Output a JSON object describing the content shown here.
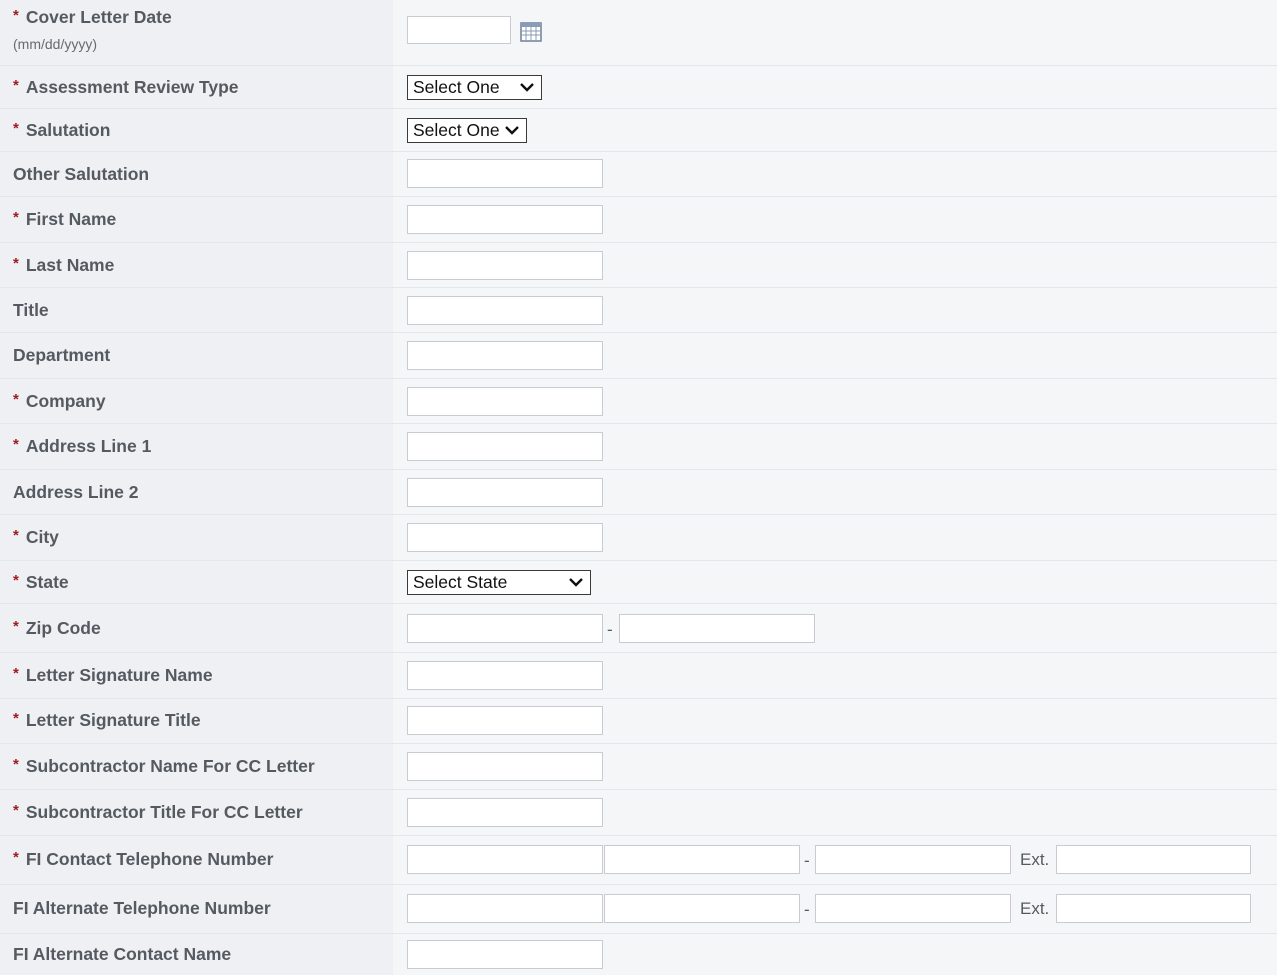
{
  "form": {
    "cover_letter_date": {
      "label": "Cover Letter Date",
      "hint": "(mm/dd/yyyy)",
      "value": "",
      "calendar_icon": "calendar-icon"
    },
    "assessment_review_type": {
      "label": "Assessment Review Type",
      "selected": "Select One"
    },
    "salutation": {
      "label": "Salutation",
      "selected": "Select One"
    },
    "other_salutation": {
      "label": "Other Salutation",
      "value": ""
    },
    "first_name": {
      "label": "First Name",
      "value": ""
    },
    "last_name": {
      "label": "Last Name",
      "value": ""
    },
    "title": {
      "label": "Title",
      "value": ""
    },
    "department": {
      "label": "Department",
      "value": ""
    },
    "company": {
      "label": "Company",
      "value": ""
    },
    "address_line_1": {
      "label": "Address Line 1",
      "value": ""
    },
    "address_line_2": {
      "label": "Address Line 2",
      "value": ""
    },
    "city": {
      "label": "City",
      "value": ""
    },
    "state": {
      "label": "State",
      "selected": "Select State"
    },
    "zip_code": {
      "label": "Zip Code",
      "separator": "-",
      "value": "",
      "extension": ""
    },
    "letter_signature_name": {
      "label": "Letter Signature Name",
      "value": ""
    },
    "letter_signature_title": {
      "label": "Letter Signature Title",
      "value": ""
    },
    "subcontractor_name_cc": {
      "label": "Subcontractor Name For CC Letter",
      "value": ""
    },
    "subcontractor_title_cc": {
      "label": "Subcontractor Title For CC Letter",
      "value": ""
    },
    "fi_contact_phone": {
      "label": "FI Contact Telephone Number",
      "separator": "-",
      "ext_label": "Ext."
    },
    "fi_alternate_phone": {
      "label": "FI Alternate Telephone Number",
      "separator": "-",
      "ext_label": "Ext."
    },
    "fi_alternate_contact_name": {
      "label": "FI Alternate Contact Name",
      "value": ""
    }
  },
  "required_marker": "*",
  "colors": {
    "required_star": "#a3191c",
    "label_text": "#555a61",
    "label_bg": "#eef0f3",
    "field_bg": "#f5f6f8"
  }
}
